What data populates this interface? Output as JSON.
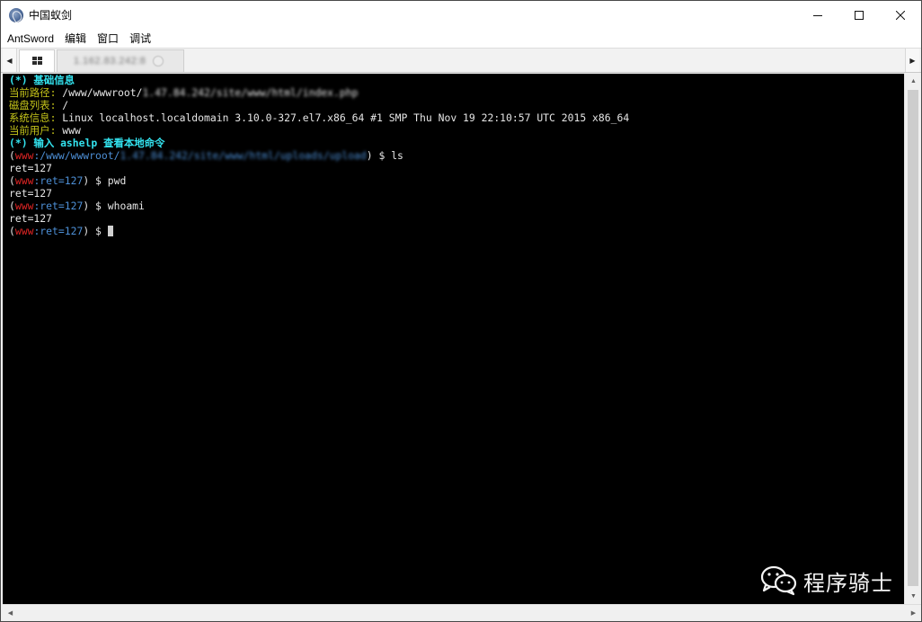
{
  "window": {
    "title": "中国蚁剑",
    "icon": "antsword-logo-icon"
  },
  "menu": [
    "AntSword",
    "编辑",
    "窗口",
    "调试"
  ],
  "tabs": {
    "home_icon": "grid-icon",
    "session_label": "1.162.83.242:8"
  },
  "terminal": {
    "lines": [
      [
        {
          "t": "(*) 基础信息",
          "c": "c-cyan"
        }
      ],
      [
        {
          "t": "当前路径:",
          "c": "c-yellow"
        },
        {
          "t": " /www/wwwroot/",
          "c": "c-white"
        },
        {
          "t": "1.47.84.242/site/www/html/index.php",
          "c": "c-white blur"
        }
      ],
      [
        {
          "t": "磁盘列表:",
          "c": "c-yellow"
        },
        {
          "t": " /",
          "c": "c-white"
        }
      ],
      [
        {
          "t": "系统信息:",
          "c": "c-yellow"
        },
        {
          "t": " Linux localhost.localdomain 3.10.0-327.el7.x86_64 #1 SMP Thu Nov 19 22:10:57 UTC 2015 x86_64",
          "c": "c-white"
        }
      ],
      [
        {
          "t": "当前用户:",
          "c": "c-yellow"
        },
        {
          "t": " www",
          "c": "c-white"
        }
      ],
      [
        {
          "t": "(*) 输入 ashelp 查看本地命令",
          "c": "c-cyan"
        }
      ],
      [
        {
          "t": "(",
          "c": "c-white"
        },
        {
          "t": "www",
          "c": "c-red"
        },
        {
          "t": ":/www/wwwroot/",
          "c": "c-blue"
        },
        {
          "t": "1.47.84.242/site/www/html/uploads/upload",
          "c": "c-blue blur"
        },
        {
          "t": ") $ ls",
          "c": "c-white"
        }
      ],
      [
        {
          "t": "ret=127",
          "c": "c-white"
        }
      ],
      [
        {
          "t": "(",
          "c": "c-white"
        },
        {
          "t": "www",
          "c": "c-red"
        },
        {
          "t": ":ret=127",
          "c": "c-blue"
        },
        {
          "t": ") $ pwd",
          "c": "c-white"
        }
      ],
      [
        {
          "t": "ret=127",
          "c": "c-white"
        }
      ],
      [
        {
          "t": "(",
          "c": "c-white"
        },
        {
          "t": "www",
          "c": "c-red"
        },
        {
          "t": ":ret=127",
          "c": "c-blue"
        },
        {
          "t": ") $ whoami",
          "c": "c-white"
        }
      ],
      [
        {
          "t": "ret=127",
          "c": "c-white"
        }
      ],
      [
        {
          "t": "(",
          "c": "c-white"
        },
        {
          "t": "www",
          "c": "c-red"
        },
        {
          "t": ":ret=127",
          "c": "c-blue"
        },
        {
          "t": ") $ ",
          "c": "c-white"
        }
      ]
    ]
  },
  "watermark": {
    "icon": "wechat-icon",
    "text": "程序骑士"
  }
}
